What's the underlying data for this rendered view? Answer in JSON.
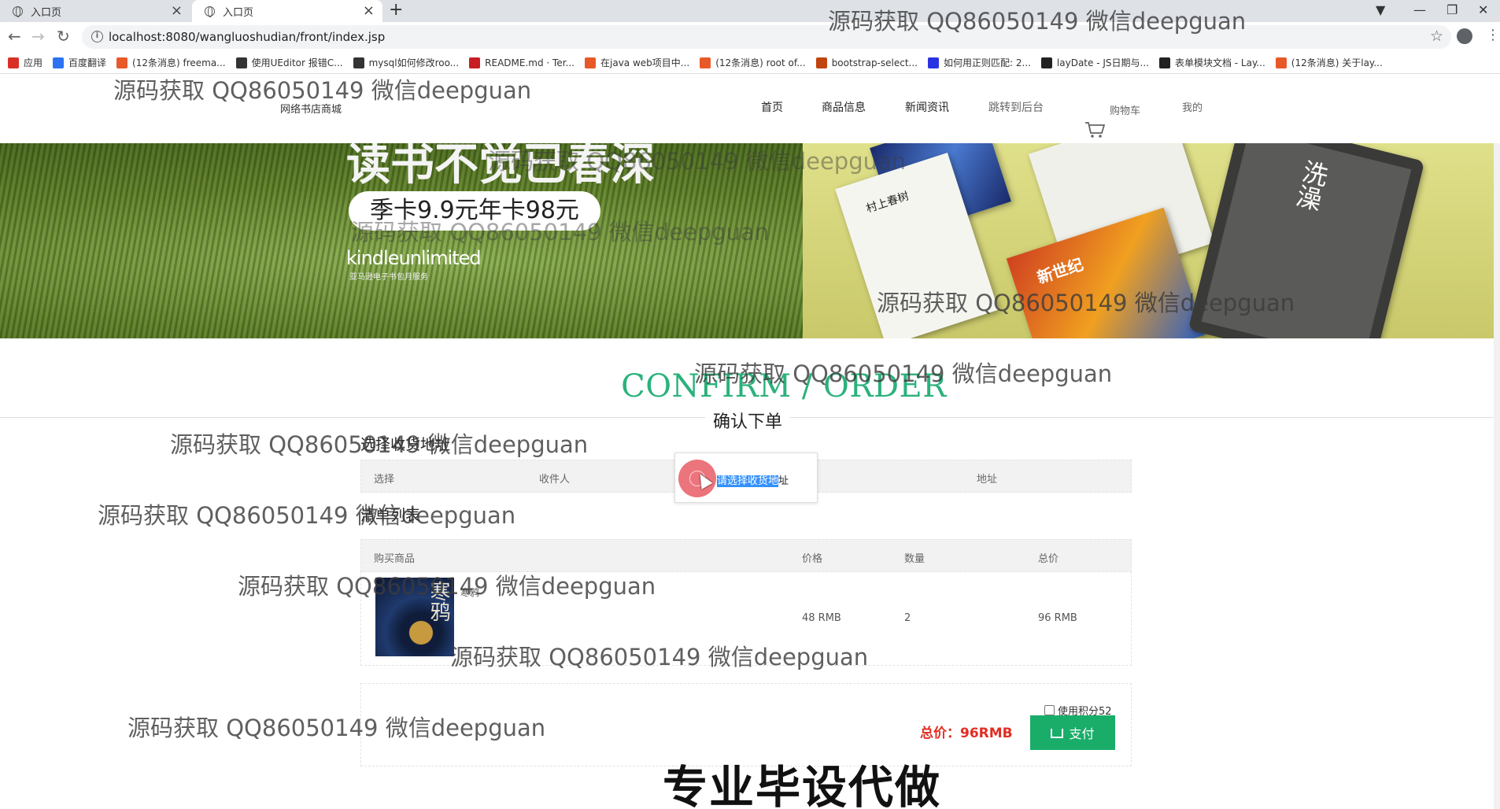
{
  "browser": {
    "tabs": [
      {
        "title": "入口页",
        "close": "×"
      },
      {
        "title": "入口页",
        "close": "×"
      }
    ],
    "new_tab": "+",
    "url": "localhost:8080/wangluoshudian/front/index.jsp",
    "bookmarks": [
      {
        "label": "应用",
        "icon": "apps-icon",
        "color": "#d93025"
      },
      {
        "label": "百度翻译",
        "icon": "baidu-translate-icon",
        "color": "#2b73f0"
      },
      {
        "label": "(12条消息) freema...",
        "icon": "csdn-icon",
        "color": "#e8592a"
      },
      {
        "label": "使用UEditor 报错C...",
        "icon": "segment-icon",
        "color": "#333333"
      },
      {
        "label": "mysql如何修改roo...",
        "icon": "segment-icon",
        "color": "#333333"
      },
      {
        "label": "README.md · Ter...",
        "icon": "gitee-icon",
        "color": "#c71d23"
      },
      {
        "label": "在java web项目中...",
        "icon": "csdn-icon",
        "color": "#e8592a"
      },
      {
        "label": "(12条消息) root of...",
        "icon": "csdn-icon",
        "color": "#e8592a"
      },
      {
        "label": "bootstrap-select...",
        "icon": "site-icon",
        "color": "#c1440e"
      },
      {
        "label": "如何用正则匹配: 2...",
        "icon": "baidu-icon",
        "color": "#2932e1"
      },
      {
        "label": "layDate - JS日期与...",
        "icon": "layui-icon",
        "color": "#222222"
      },
      {
        "label": "表单模块文档 - Lay...",
        "icon": "layui-icon",
        "color": "#222222"
      },
      {
        "label": "(12条消息) 关于lay...",
        "icon": "csdn-icon",
        "color": "#e8592a"
      }
    ]
  },
  "site": {
    "name": "网络书店商城",
    "nav": [
      "首页",
      "商品信息",
      "新闻资讯",
      "跳转到后台",
      "购物车",
      "我的"
    ]
  },
  "banner": {
    "headline": "读书不觉已春深",
    "pill": "季卡9.9元年卡98元",
    "brand": "kindleunlimited",
    "brand_sub": "亚马逊电子书包月服务",
    "book_titles": [
      "村上春树",
      "新世纪",
      "洗澡"
    ]
  },
  "order": {
    "heading": "CONFIRM / ORDER",
    "subheading": "确认下单",
    "address_section": "选择收货地址",
    "address_columns": [
      "选择",
      "收件人",
      "地址"
    ],
    "address_popup_highlight": "请选择收货地",
    "address_popup_rest": "址",
    "list_section": "清单列表",
    "item_columns": [
      "购买商品",
      "价格",
      "数量",
      "总价"
    ],
    "items": [
      {
        "name": "寒鸦",
        "cover_title": "寒鸦",
        "price": "48 RMB",
        "qty": "2",
        "total": "96 RMB"
      }
    ],
    "points_label": "使用积分52",
    "total_label": "总价：96RMB",
    "pay_label": "支付"
  },
  "watermark": {
    "text": "源码获取 QQ86050149 微信deepguan",
    "bottom_text": "专业毕设代做"
  },
  "colors": {
    "accent_green": "#2ab27b",
    "pay_green": "#1aad6a",
    "total_red": "#e02e24",
    "highlight_blue": "#3390ff"
  }
}
